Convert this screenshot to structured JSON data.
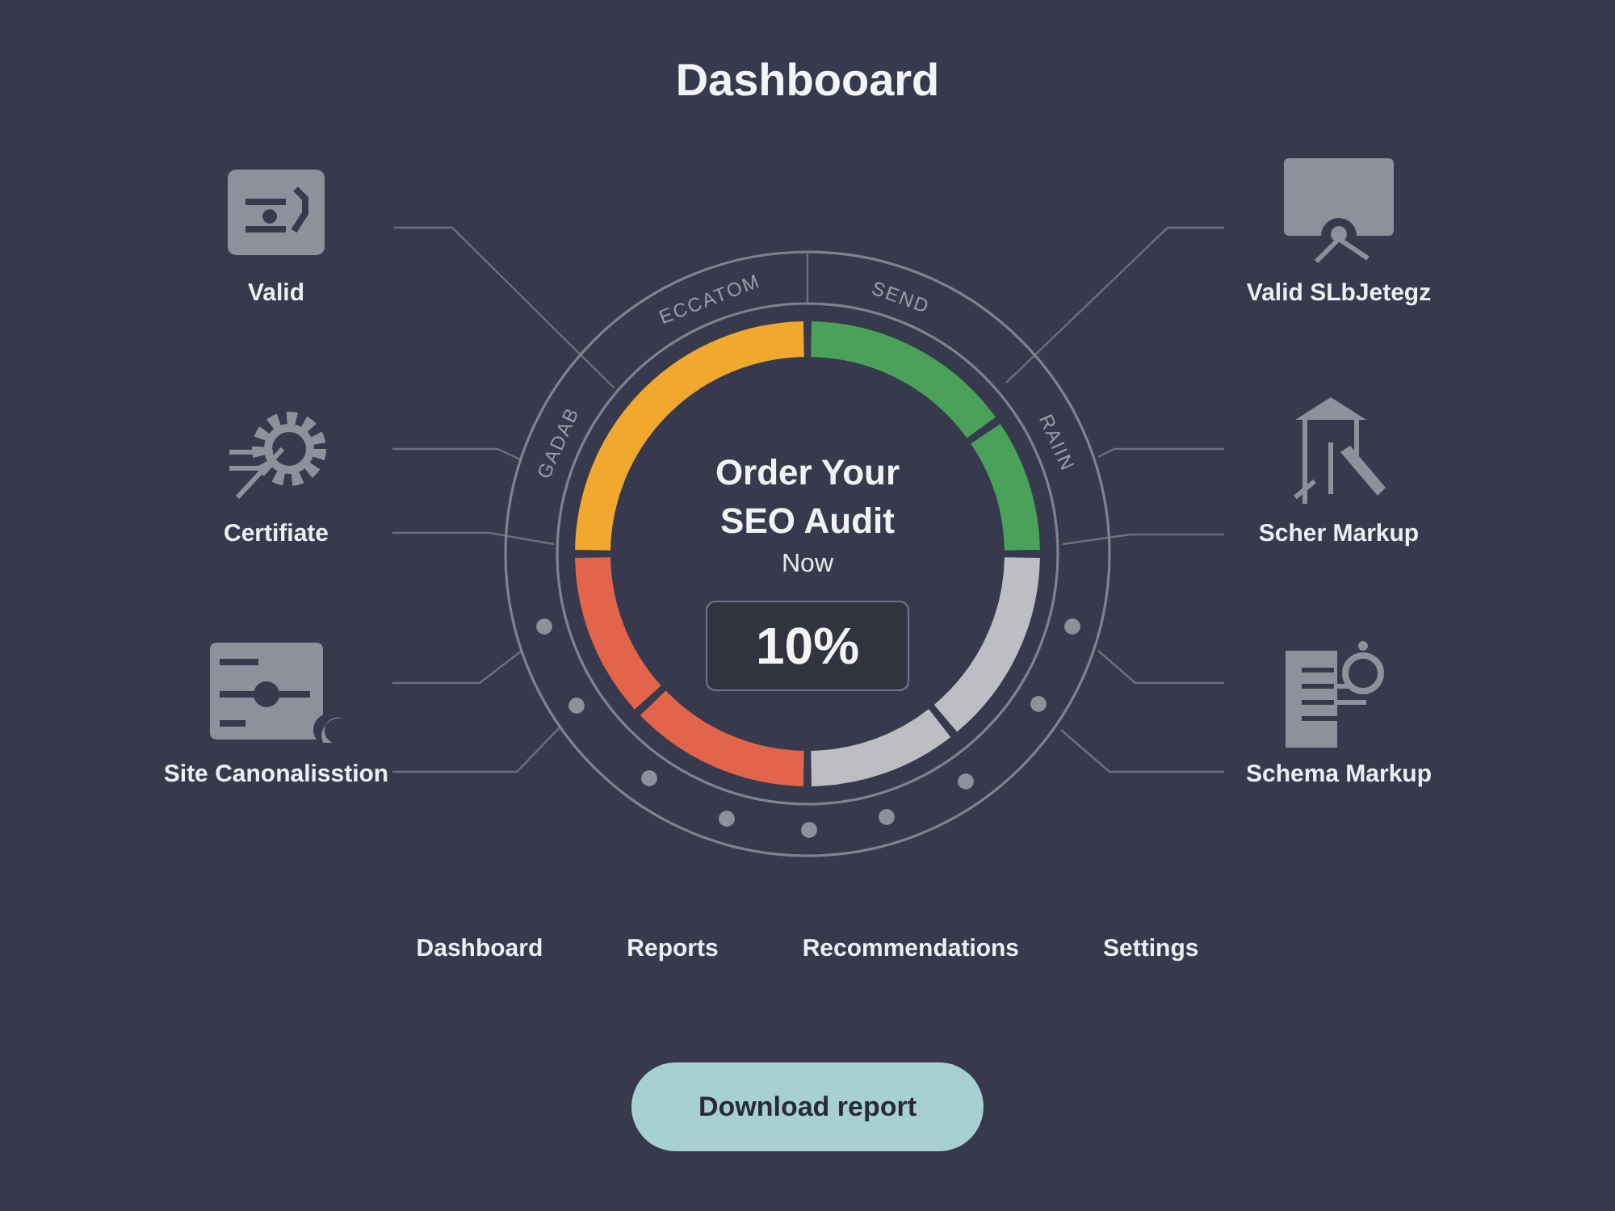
{
  "title": "Dashbooard",
  "left_features": [
    {
      "label": "Valid"
    },
    {
      "label": "Certifiate"
    },
    {
      "label": "Site Canonalisstion"
    }
  ],
  "right_features": [
    {
      "label": "Valid SLbJetegz"
    },
    {
      "label": "Scher Markup"
    },
    {
      "label": "Schema Markup"
    }
  ],
  "dial": {
    "ring_labels": [
      "ECCATOM",
      "SEND",
      "GADAB",
      "RAIIN"
    ],
    "headline": [
      "Order Your",
      "SEO Audit"
    ],
    "subline": "Now",
    "score": "10%"
  },
  "nav": [
    "Dashboard",
    "Reports",
    "Recommendations",
    "Settings"
  ],
  "download_button": "Download report"
}
